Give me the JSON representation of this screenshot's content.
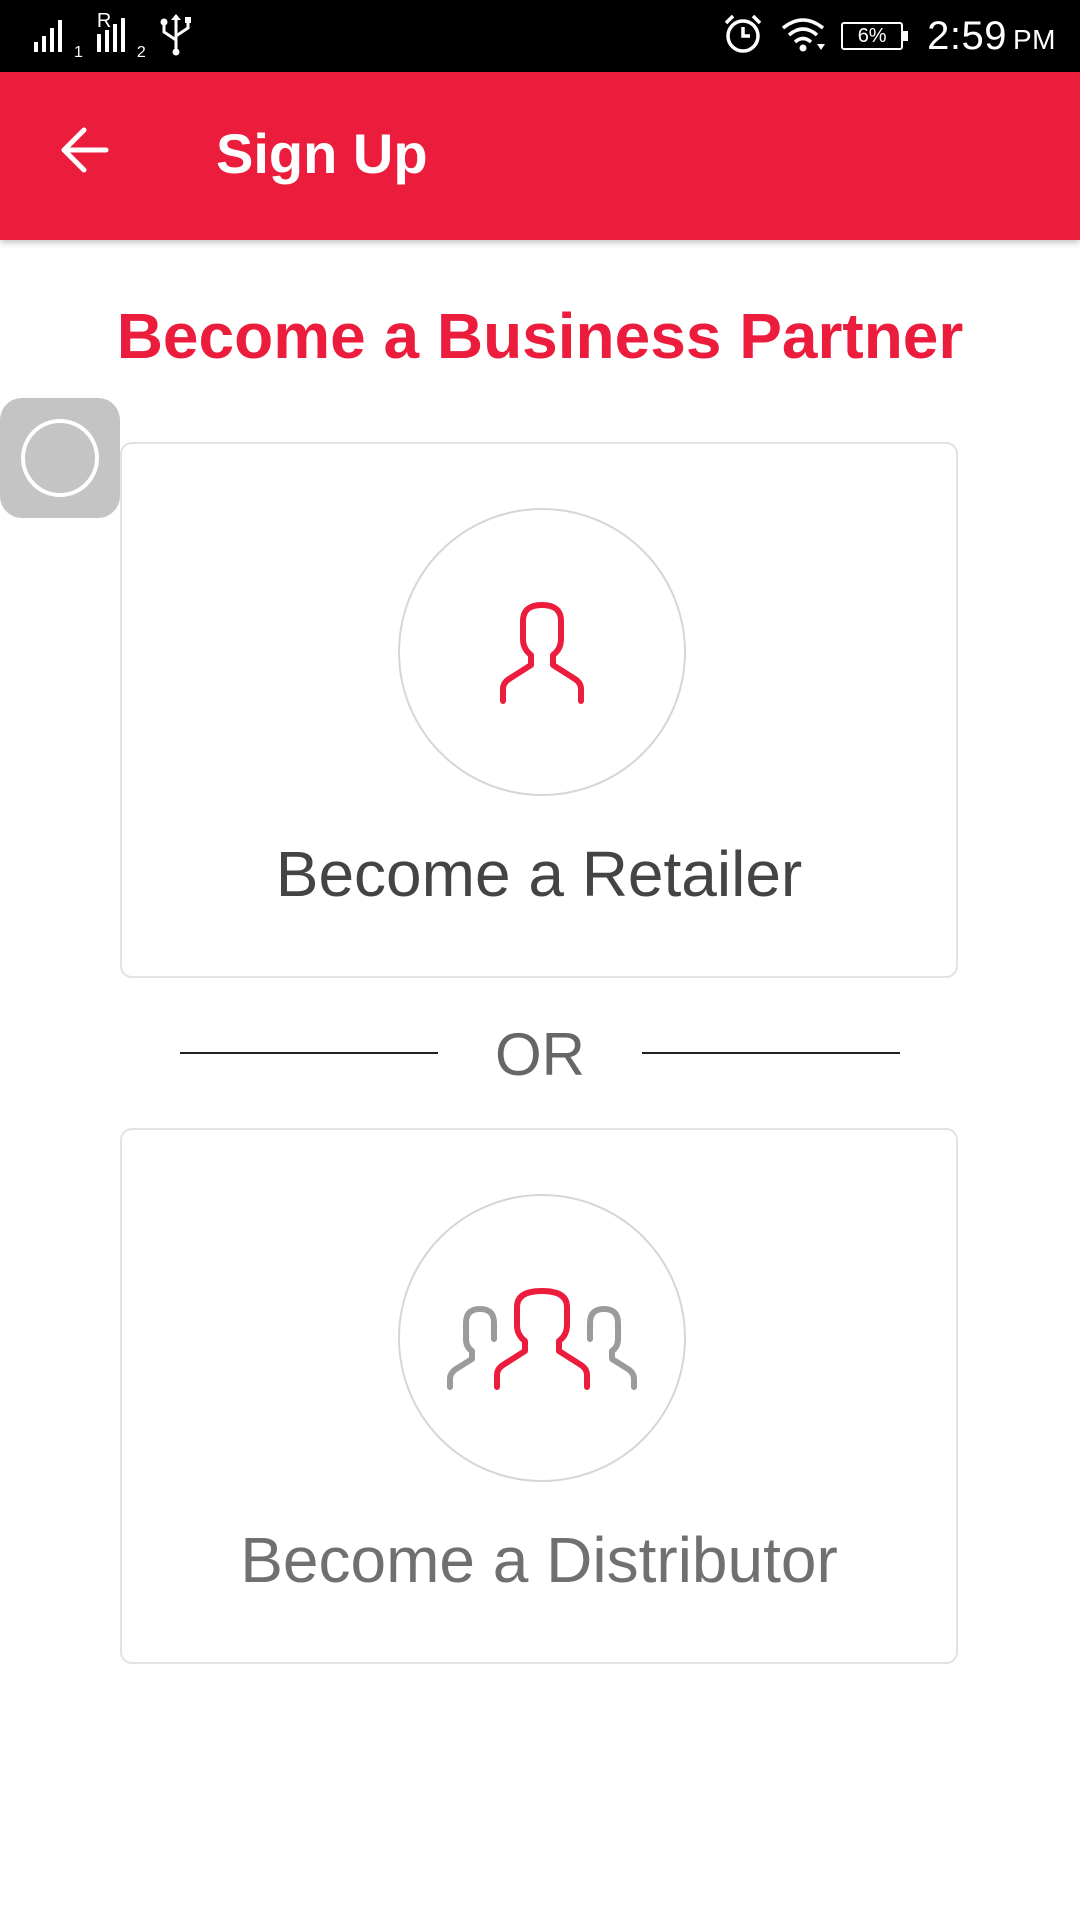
{
  "status_bar": {
    "sim1_label": "1",
    "sim2_label": "2",
    "roaming_label": "R",
    "battery_percent": "6%",
    "time": "2:59",
    "ampm": "PM",
    "icons": [
      "signal-icon",
      "signal-roaming-icon",
      "usb-icon",
      "alarm-icon",
      "wifi-icon",
      "battery-icon"
    ]
  },
  "app_bar": {
    "title": "Sign Up",
    "background_color": "#ec1c3c",
    "back_icon": "arrow-left-icon"
  },
  "page": {
    "heading": "Become a Business Partner",
    "accent_color": "#ec1c3c"
  },
  "options": [
    {
      "label": "Become a Retailer",
      "icon": "single-user-icon"
    },
    {
      "label": "Become a Distributor",
      "icon": "user-group-icon"
    }
  ],
  "divider": {
    "text": "OR"
  }
}
